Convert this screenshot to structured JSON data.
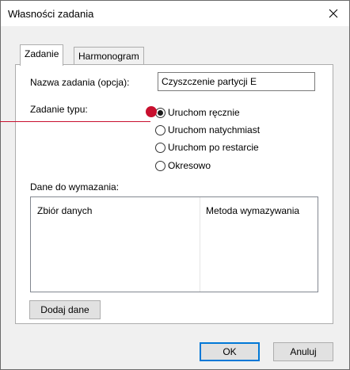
{
  "window": {
    "title": "Własności zadania",
    "close_label": "✕"
  },
  "tabs": [
    {
      "label": "Zadanie",
      "active": true
    },
    {
      "label": "Harmonogram",
      "active": false
    }
  ],
  "form": {
    "task_name_label": "Nazwa zadania (opcja):",
    "task_name_value": "Czyszczenie partycji E",
    "task_type_label": "Zadanie typu:",
    "task_type_options": [
      {
        "label": "Uruchom ręcznie",
        "checked": true
      },
      {
        "label": "Uruchom natychmiast",
        "checked": false
      },
      {
        "label": "Uruchom po restarcie",
        "checked": false
      },
      {
        "label": "Okresowo",
        "checked": false
      }
    ],
    "data_label": "Dane do wymazania:",
    "list_columns": [
      "Zbiór danych",
      "Metoda wymazywania"
    ],
    "add_data_button": "Dodaj dane"
  },
  "footer": {
    "ok_label": "OK",
    "cancel_label": "Anuluj"
  },
  "colors": {
    "annotation": "#c8102e",
    "default_button_border": "#0078d7"
  }
}
